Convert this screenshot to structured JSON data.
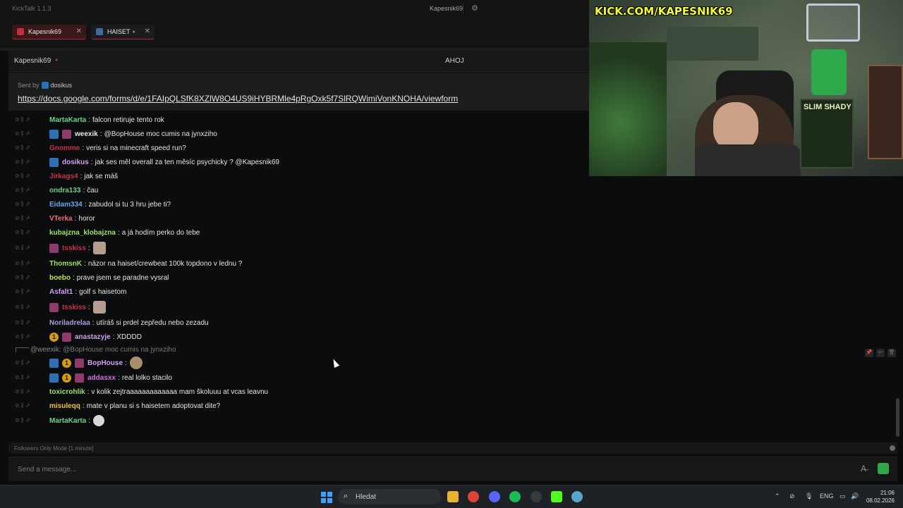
{
  "app": {
    "title": "KickTalk 1.1.3",
    "header_channel": "Kapesnik69"
  },
  "tabs": [
    {
      "label": "Kapesnik69"
    },
    {
      "label": "HAISET"
    }
  ],
  "chat_header": {
    "channel": "Kapesnik69",
    "stream_title": "AHOJ"
  },
  "pinned": {
    "sent_by_label": "Sent by",
    "user": "dosikus",
    "link": "https://docs.google.com/forms/d/e/1FAIpQLSfK8XZlW8O4US9iHYBRMle4pRgOxk5f7SlRQWimiVonKNOHA/viewform"
  },
  "stream_overlay": {
    "title": "KICK.COM/KAPESNIK69",
    "poster_text": "SLIM SHADY"
  },
  "messages": [
    {
      "user": "MartaKarta",
      "text": "falcon retiruje tento rok",
      "color": "#6fd08a"
    },
    {
      "user": "weexik",
      "text": "@BopHouse moc cumis na jynxziho",
      "color": "#e8e8e8"
    },
    {
      "user": "Gnomme",
      "text": "veris si na minecraft speed run?",
      "color": "#c8324a"
    },
    {
      "user": "dosikus",
      "text": "jak ses měl overall za ten měsíc psychicky ? @Kapesnik69",
      "color": "#d0a0f0"
    },
    {
      "user": "Jirkags4",
      "text": "jak se máš",
      "color": "#c8324a"
    },
    {
      "user": "ondra133",
      "text": "čau",
      "color": "#6fd08a"
    },
    {
      "user": "Eidam334",
      "text": "zabudol si tu 3 hru jebe ti?",
      "color": "#6aa7e8"
    },
    {
      "user": "VTerka",
      "text": "horor",
      "color": "#e8707a"
    },
    {
      "user": "kubajzna_klobajzna",
      "text": "a já hodím perko do tebe",
      "color": "#9ee06a"
    },
    {
      "user": "tsskiss",
      "text": "",
      "color": "#c8324a"
    },
    {
      "user": "ThomsnK",
      "text": "názor na haiset/crewbeat 100k topdono v lednu ?",
      "color": "#9ee06a"
    },
    {
      "user": "boebo",
      "text": "prave jsem se paradne vysral",
      "color": "#b7e25a"
    },
    {
      "user": "Asfalt1",
      "text": "golf s haisetom",
      "color": "#cfa0f0"
    },
    {
      "user": "tsskiss",
      "text": "",
      "color": "#c8324a"
    },
    {
      "user": "Noriladrelaa",
      "text": "utíráš si prdel zepředu nebo zezadu",
      "color": "#b09ae8"
    },
    {
      "user": "anastazyje",
      "text": "XDDDD",
      "color": "#d0a0f0"
    },
    {
      "reply_to_user": "@weexik:",
      "reply_to_text": "@BopHouse moc cumis na jynxziho"
    },
    {
      "user": "BopHouse",
      "text": "",
      "color": "#d0a0f0"
    },
    {
      "user": "addasxx",
      "text": "real lolko stacilo",
      "color": "#d070e0"
    },
    {
      "user": "toxicrohlik",
      "text": "v kolik zejtraaaaaaaaaaaaa mam školuuu at vcas leavnu",
      "color": "#9ee06a"
    },
    {
      "user": "misuleqq",
      "text": "mate v planu si s haisetem adoptovat dite?",
      "color": "#f0c040"
    },
    {
      "user": "MartaKarta",
      "text": "",
      "color": "#6fd08a"
    }
  ],
  "footer": {
    "mode": "Followers Only Mode [1 minute]",
    "input_placeholder": "Send a message..."
  },
  "taskbar": {
    "search_placeholder": "Hledat",
    "lang": "ENG",
    "time": "21:06",
    "date": "08.02.2026"
  }
}
